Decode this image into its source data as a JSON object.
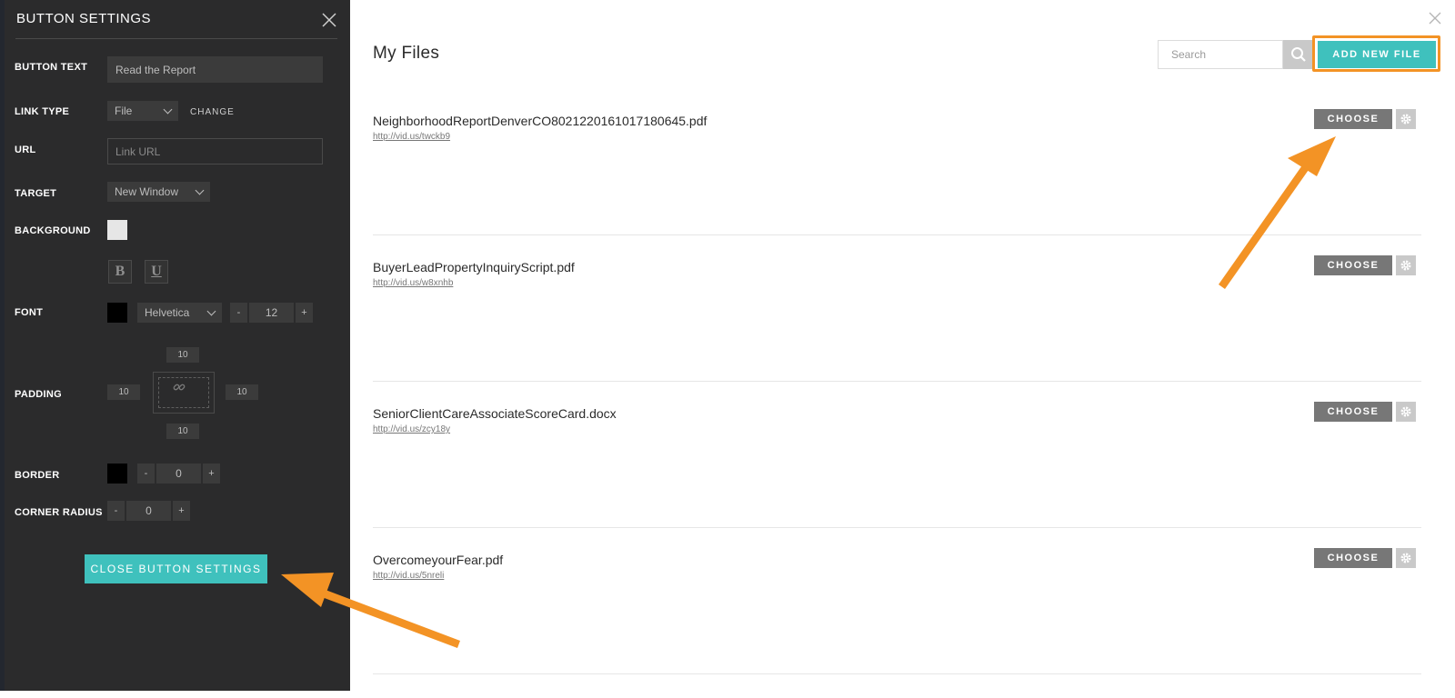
{
  "panel": {
    "title": "BUTTON SETTINGS",
    "labels": {
      "button_text": "BUTTON TEXT",
      "link_type": "LINK TYPE",
      "url": "URL",
      "target": "TARGET",
      "background": "BACKGROUND",
      "font": "FONT",
      "padding": "PADDING",
      "border": "BORDER",
      "corner_radius": "CORNER RADIUS"
    },
    "button_text_value": "Read the Report",
    "link_type_value": "File",
    "change_label": "CHANGE",
    "url_placeholder": "Link URL",
    "target_value": "New Window",
    "bold_label": "B",
    "underline_label": "U",
    "font_family": "Helvetica",
    "font_size": "12",
    "minus": "-",
    "plus": "+",
    "padding": {
      "top": "10",
      "left": "10",
      "right": "10",
      "bottom": "10"
    },
    "border_width": "0",
    "corner_radius": "0",
    "close_label": "CLOSE BUTTON SETTINGS",
    "colors": {
      "background_swatch": "#e6e6e6",
      "font_swatch": "#000000",
      "border_swatch": "#000000"
    }
  },
  "main": {
    "title": "My Files",
    "search_placeholder": "Search",
    "add_label": "ADD NEW FILE",
    "choose_label": "CHOOSE",
    "files": [
      {
        "name": "NeighborhoodReportDenverCO8021220161017180645.pdf",
        "url": "http://vid.us/twckb9"
      },
      {
        "name": "BuyerLeadPropertyInquiryScript.pdf",
        "url": "http://vid.us/w8xnhb"
      },
      {
        "name": "SeniorClientCareAssociateScoreCard.docx",
        "url": "http://vid.us/zcy18y"
      },
      {
        "name": "OvercomeyourFear.pdf",
        "url": "http://vid.us/5nreli"
      }
    ]
  },
  "theme": {
    "accent": "#3fc1bd",
    "highlight": "#f39325",
    "panel_bg": "#2b2b2c"
  },
  "icons": [
    "close-icon",
    "chevron-down-icon",
    "link-icon",
    "search-icon",
    "gear-icon",
    "arrow-annotation"
  ]
}
